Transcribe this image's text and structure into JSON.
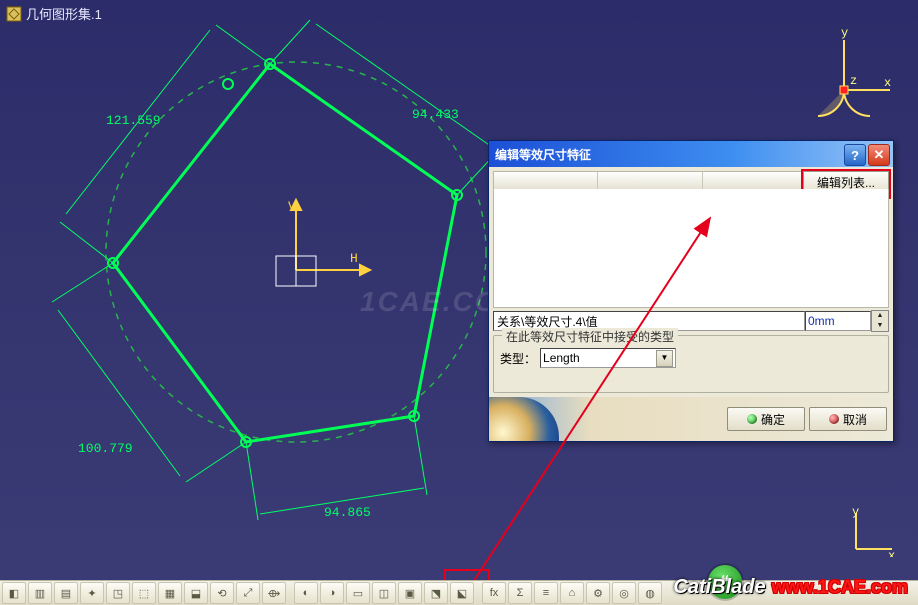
{
  "tree": {
    "root_label": "几何图形集.1"
  },
  "axis": {
    "x": "x",
    "y": "y",
    "z": "z",
    "h": "H",
    "v": "V"
  },
  "dimensions": {
    "d1": "121.559",
    "d2": "94.433",
    "d3": "100.779",
    "d4": "94.865"
  },
  "watermark_center": "1CAE.COM",
  "dialog": {
    "title": "编辑等效尺寸特征",
    "help_icon": "?",
    "close_icon": "✕",
    "edit_list_btn": "编辑列表...",
    "path_value": "关系\\等效尺寸.4\\值",
    "spin_value": "0mm",
    "group_title": "在此等效尺寸特征中接受的类型",
    "type_label": "类型：",
    "type_value": "Length",
    "ok_label": "确定",
    "cancel_label": "取消"
  },
  "toolbar": {
    "icons": [
      "tool",
      "tool",
      "tool",
      "tool",
      "tool",
      "tool",
      "tool",
      "tool",
      "tool",
      "tool",
      "tool",
      "tool",
      "tool",
      "tool",
      "tool",
      "tool",
      "tool",
      "tool",
      "tool",
      "tool",
      "tool",
      "tool",
      "tool",
      "tool",
      "tool"
    ]
  },
  "site": {
    "cati": "CatiBlade",
    "url": "www.1CAE.com"
  },
  "chart_data": {
    "type": "diagram",
    "description": "CATIA sketch: pentagon inscribed in a construction circle with 4 dimension callouts",
    "edge_lengths": {
      "top_left": 121.559,
      "top_right": 94.433,
      "lower_left": 100.779,
      "bottom": 94.865
    }
  }
}
